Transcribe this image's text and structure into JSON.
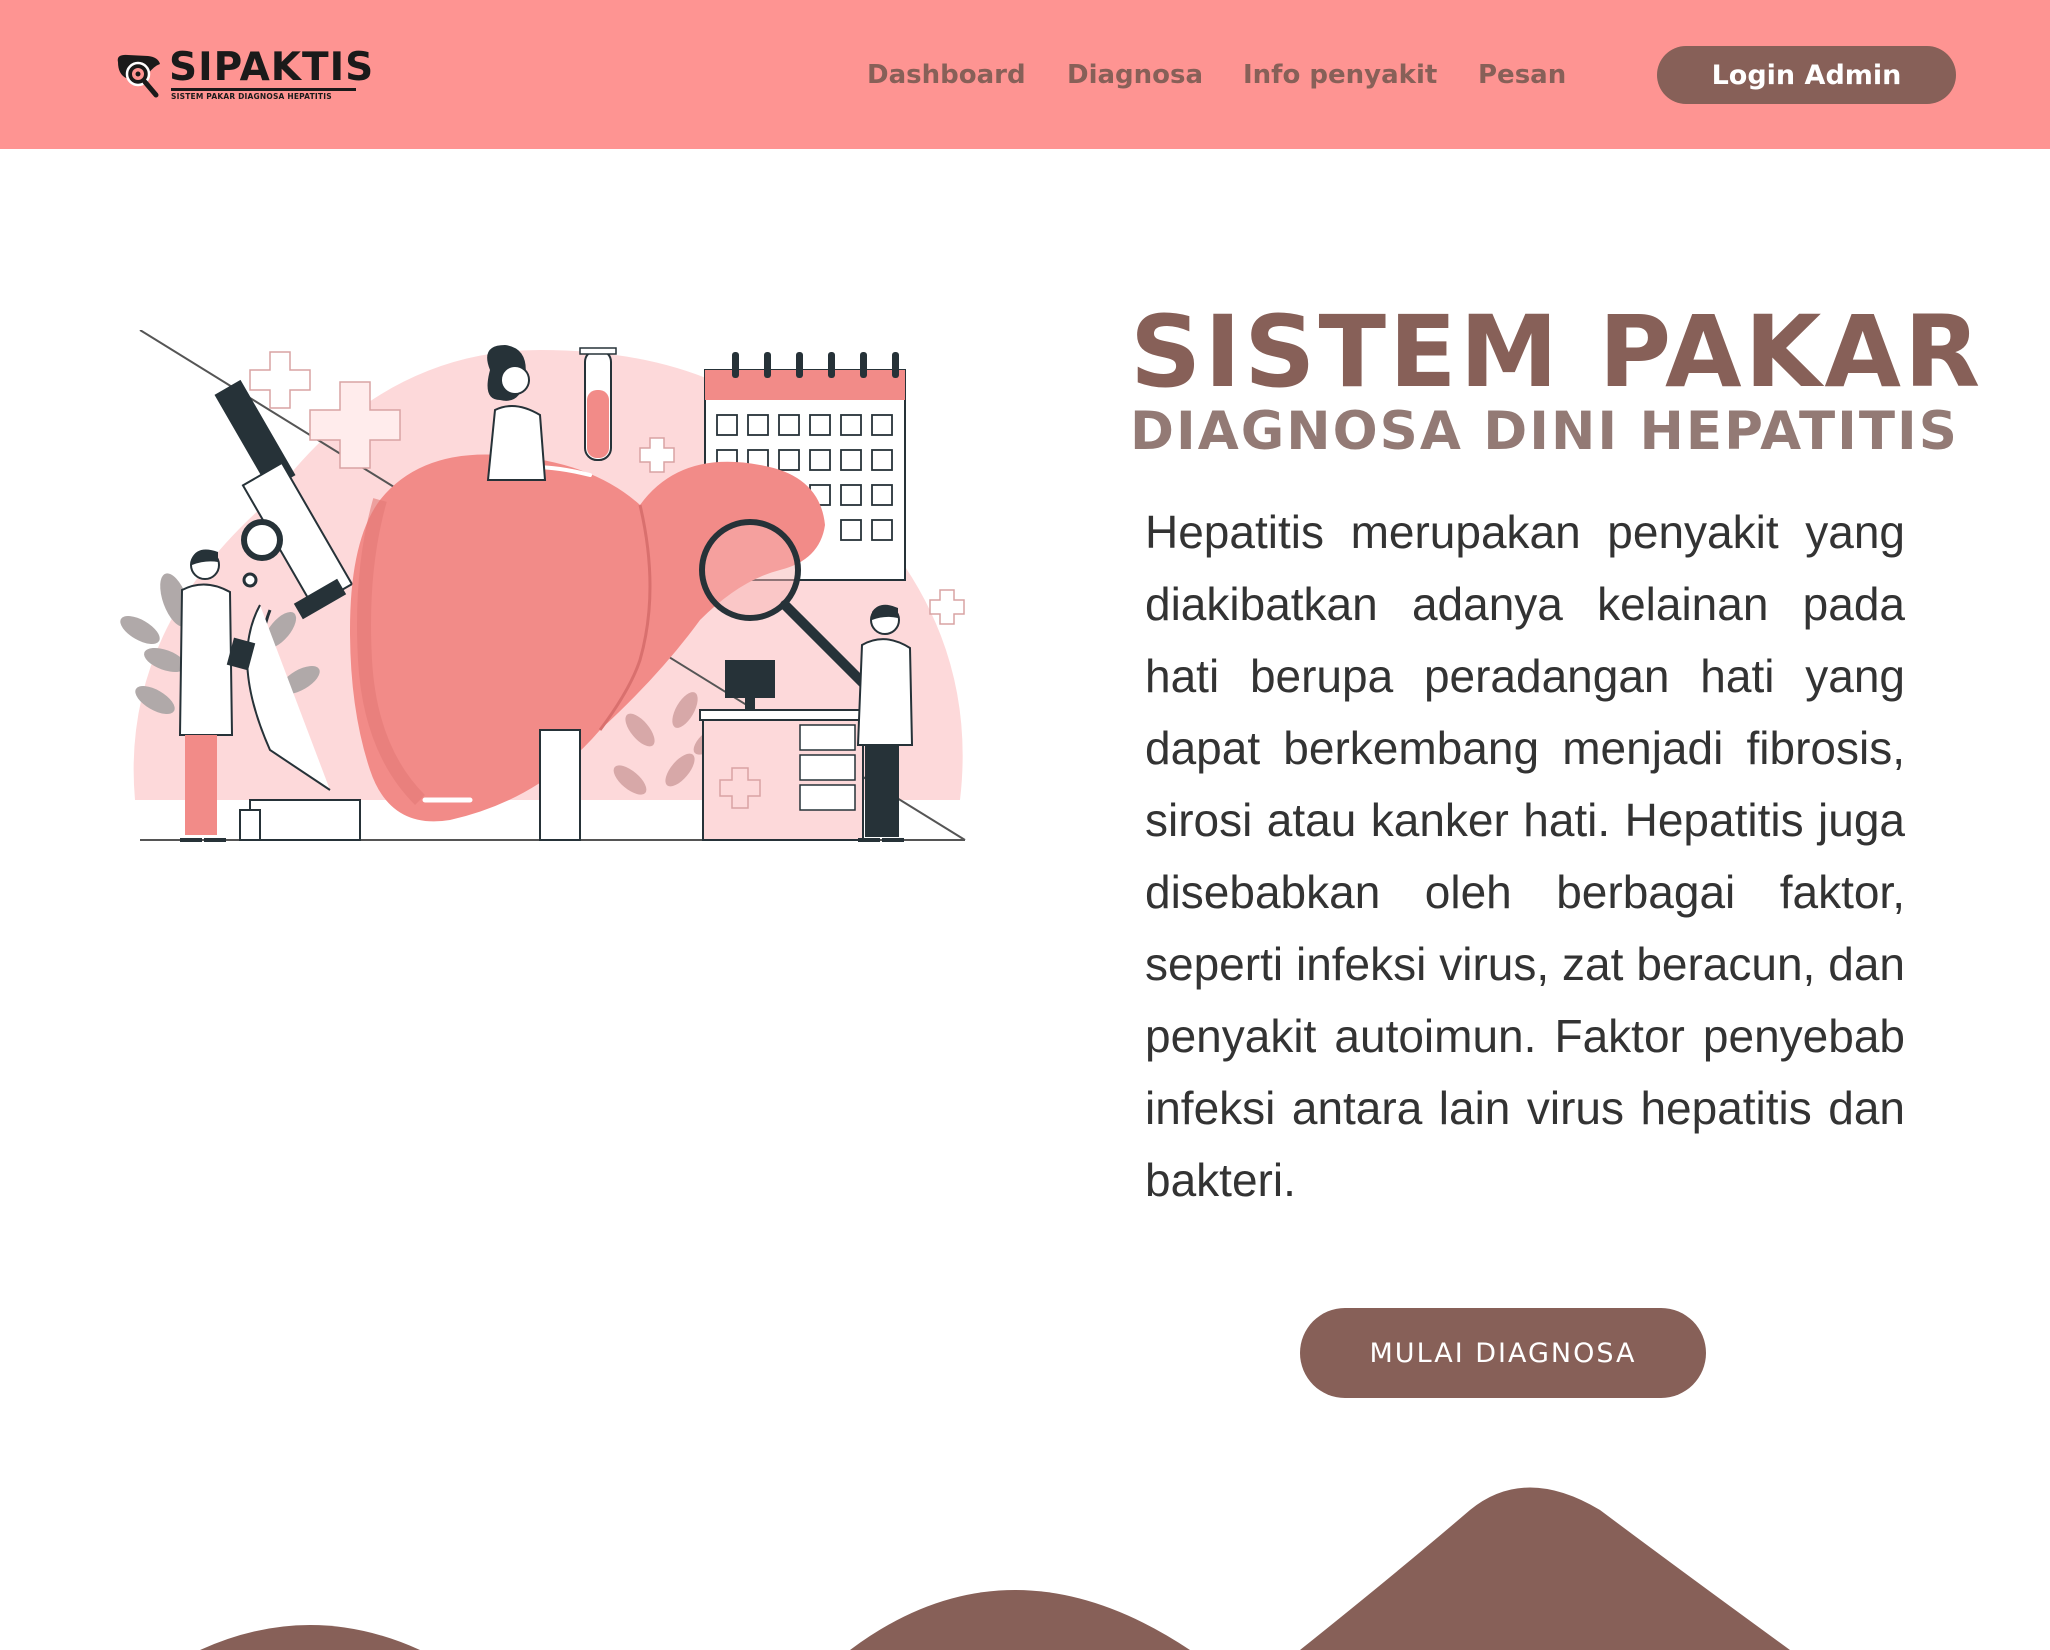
{
  "brand": {
    "name": "SIPAKTIS",
    "subtitle": "SISTEM PAKAR DIAGNOSA HEPATITIS"
  },
  "nav": {
    "items": [
      {
        "label": "Dashboard"
      },
      {
        "label": "Diagnosa"
      },
      {
        "label": "Info penyakit"
      },
      {
        "label": "Pesan"
      }
    ],
    "login_label": "Login Admin"
  },
  "hero": {
    "title": "SISTEM PAKAR",
    "subtitle": "DIAGNOSA DINI HEPATITIS",
    "description": "Hepatitis merupakan penyakit yang diakibatkan adanya kelainan pada hati berupa peradangan hati yang dapat berkembang menjadi fibrosis, sirosi atau kanker hati. Hepatitis juga disebabkan oleh berbagai faktor, seperti infeksi virus, zat beracun, dan penyakit autoimun. Faktor penyebab infeksi antara lain virus hepatitis dan bakteri.",
    "cta_label": "MULAI DIAGNOSA"
  },
  "colors": {
    "header_bg": "#fe9492",
    "primary_brown": "#876058",
    "subtitle_brown": "#937a75",
    "body_text": "#333333",
    "liver_pink": "#f28b88",
    "blob_pink": "#fdd9da"
  },
  "icons": {
    "logo": "liver-magnifier-icon"
  }
}
